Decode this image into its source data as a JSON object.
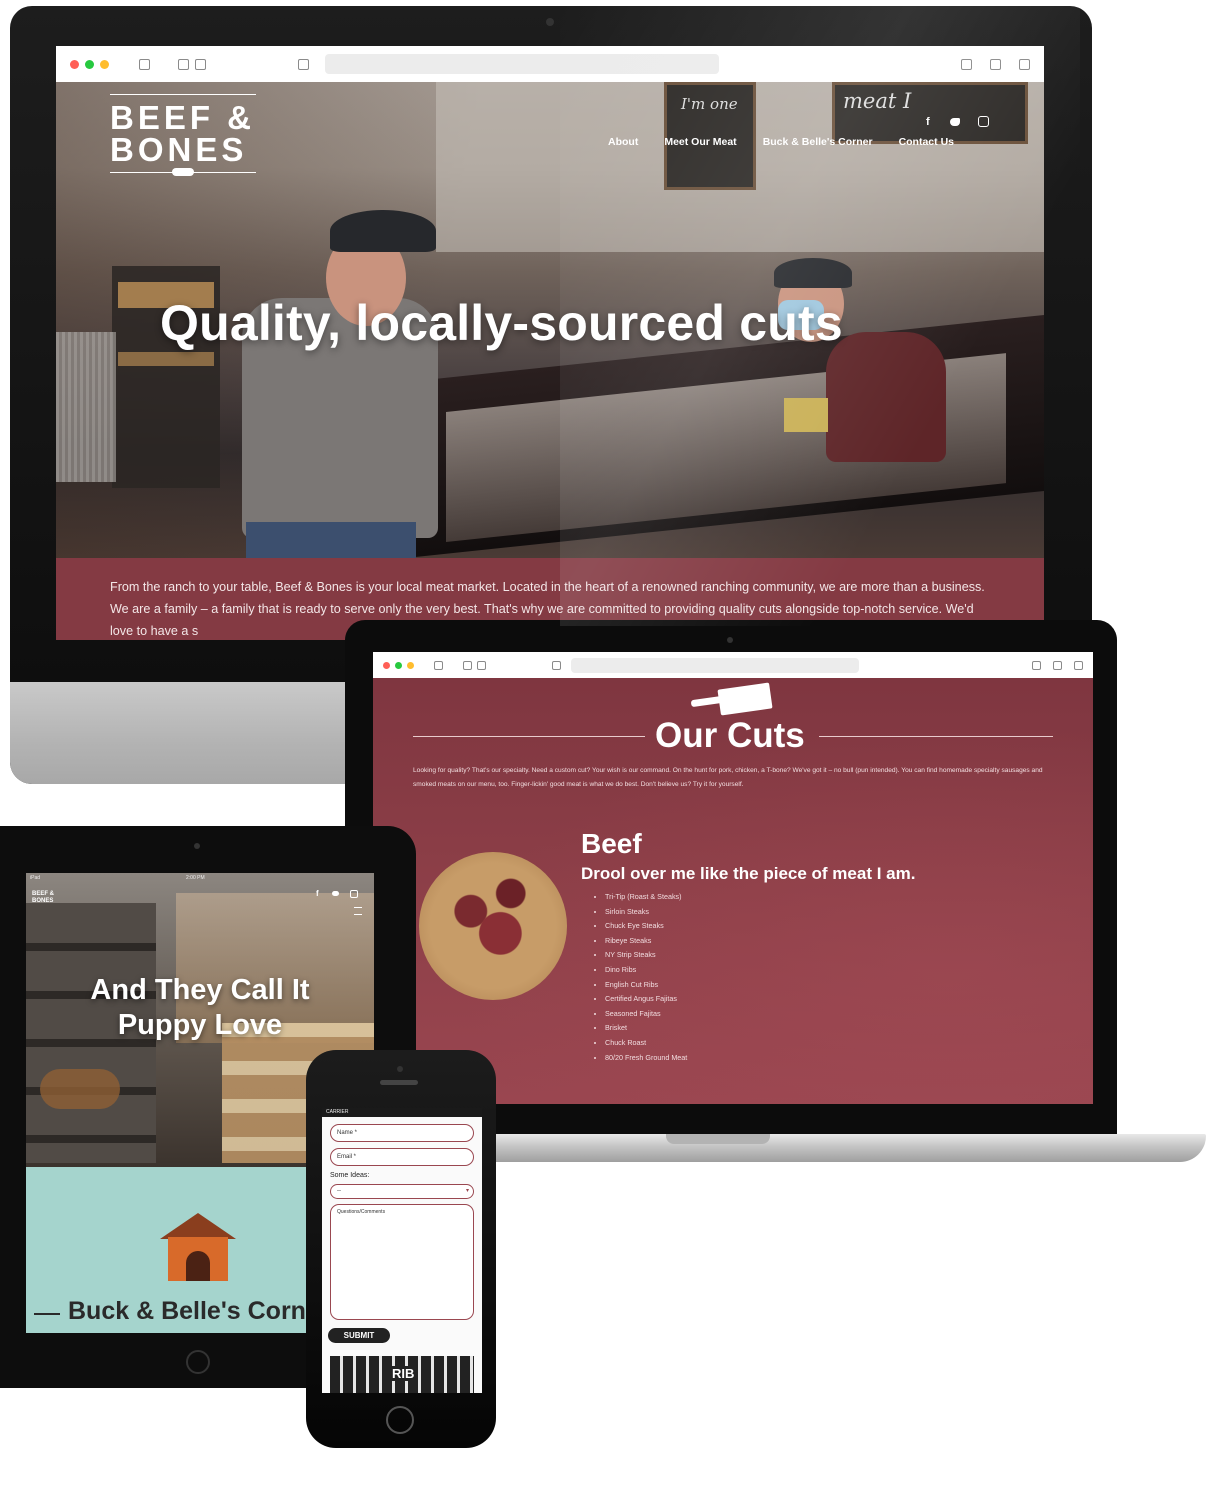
{
  "imac": {
    "brand": {
      "line1": "BEEF &",
      "line2": "BONES"
    },
    "nav": [
      "About",
      "Meet Our Meat",
      "Buck & Belle's Corner",
      "Contact Us"
    ],
    "social_icons": [
      "facebook-icon",
      "twitter-icon",
      "instagram-icon"
    ],
    "hero_title": "Quality, locally-sourced cuts",
    "chalkboard_left": "I'm one",
    "chalkboard_right": "meat I",
    "intro": "From the ranch to your table, Beef & Bones is your local meat market. Located in the heart of a renowned ranching community, we are more than a business. We are a family – a family that is ready to serve only the very best. That's why we are committed to providing quality cuts alongside top-notch service. We'd love to have a s"
  },
  "macbook": {
    "section_title": "Our Cuts",
    "intro": "Looking for quality? That's our specialty. Need a custom cut? Your wish is our command. On the hunt for pork, chicken, a T-bone? We've got it – no bull (pun intended). You can find homemade specialty sausages and smoked meats on our menu, too. Finger-lickin' good meat is what we do best. Don't believe us? Try it for yourself.",
    "category_title": "Beef",
    "category_tagline": "Drool over me like the piece of meat I am.",
    "beef_items": [
      "Tri-Tip (Roast & Steaks)",
      "Sirloin Steaks",
      "Chuck Eye Steaks",
      "Ribeye Steaks",
      "NY Strip Steaks",
      "Dino Ribs",
      "English Cut Ribs",
      "Certified Angus Fajitas",
      "Seasoned Fajitas",
      "Brisket",
      "Chuck Roast",
      "80/20 Fresh Ground Meat"
    ]
  },
  "ipad": {
    "status_left": "iPad",
    "status_center": "2:00 PM",
    "brand": "BEEF & BONES",
    "hero_title_line1": "And They Call It",
    "hero_title_line2": "Puppy Love",
    "section_title": "Buck & Belle's Corn"
  },
  "iphone": {
    "status": "CARRIER",
    "name_placeholder": "Name *",
    "email_placeholder": "Email *",
    "ideas_label": "Some Ideas:",
    "ideas_value": "--",
    "comments_placeholder": "Questions/Comments",
    "submit_label": "SUBMIT",
    "footer_art_text": "RIB"
  },
  "colors": {
    "brand_maroon": "#843a43",
    "ipad_teal": "#a5d4cd",
    "traffic_red": "#ff5f56",
    "traffic_yellow": "#ffbd2e",
    "traffic_green": "#27c93f"
  }
}
